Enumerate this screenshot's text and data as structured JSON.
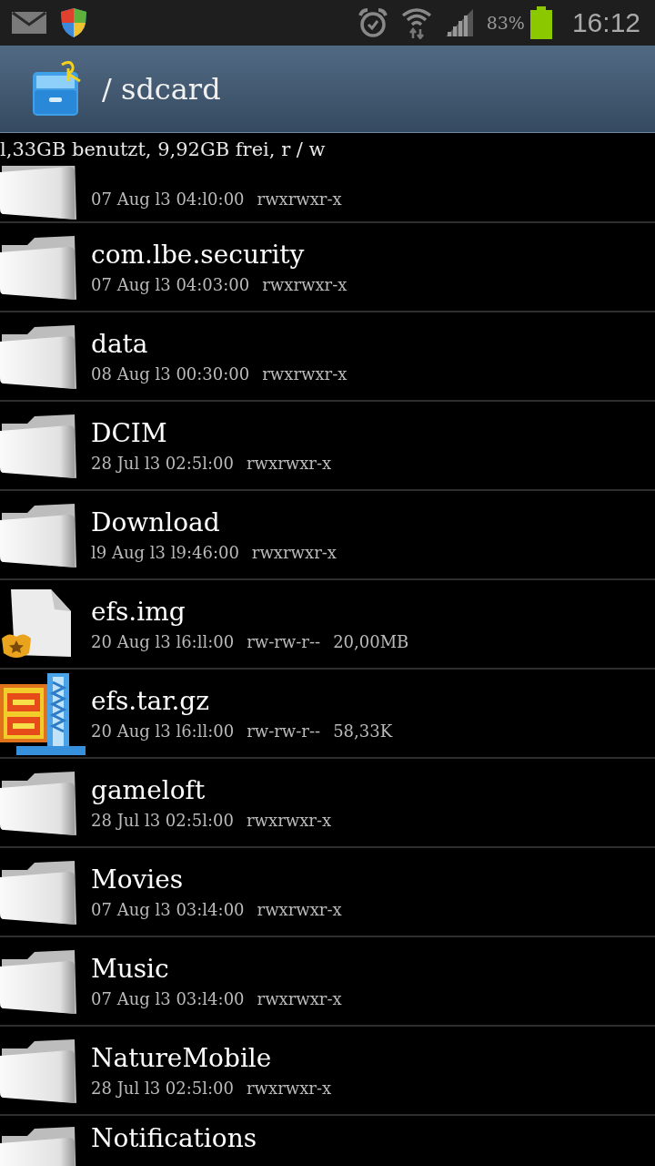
{
  "status_bar": {
    "battery": "83%",
    "time": "16:12"
  },
  "header": {
    "title": "/ sdcard"
  },
  "storage_info": "l,33GB benutzt, 9,92GB frei, r / w",
  "files": [
    {
      "kind": "folder",
      "date": "07 Aug l3 04:l0:00",
      "permissions": "rwxrwxr-x"
    },
    {
      "kind": "folder",
      "name": "com.lbe.security",
      "date": "07 Aug l3 04:03:00",
      "permissions": "rwxrwxr-x"
    },
    {
      "kind": "folder",
      "name": "data",
      "date": "08 Aug l3 00:30:00",
      "permissions": "rwxrwxr-x"
    },
    {
      "kind": "folder",
      "name": "DCIM",
      "date": "28 Jul l3 02:5l:00",
      "permissions": "rwxrwxr-x"
    },
    {
      "kind": "folder",
      "name": "Download",
      "date": "l9 Aug l3 l9:46:00",
      "permissions": "rwxrwxr-x"
    },
    {
      "kind": "image",
      "name": "efs.img",
      "date": "20 Aug l3 l6:ll:00",
      "permissions": "rw-rw-r--",
      "size": "20,00MB"
    },
    {
      "kind": "archive",
      "name": "efs.tar.gz",
      "date": "20 Aug l3 l6:ll:00",
      "permissions": "rw-rw-r--",
      "size": "58,33K"
    },
    {
      "kind": "folder",
      "name": "gameloft",
      "date": "28 Jul l3 02:5l:00",
      "permissions": "rwxrwxr-x"
    },
    {
      "kind": "folder",
      "name": "Movies",
      "date": "07 Aug l3 03:l4:00",
      "permissions": "rwxrwxr-x"
    },
    {
      "kind": "folder",
      "name": "Music",
      "date": "07 Aug l3 03:l4:00",
      "permissions": "rwxrwxr-x"
    },
    {
      "kind": "folder",
      "name": "NatureMobile",
      "date": "28 Jul l3 02:5l:00",
      "permissions": "rwxrwxr-x"
    },
    {
      "kind": "folder",
      "name": "Notifications"
    }
  ]
}
